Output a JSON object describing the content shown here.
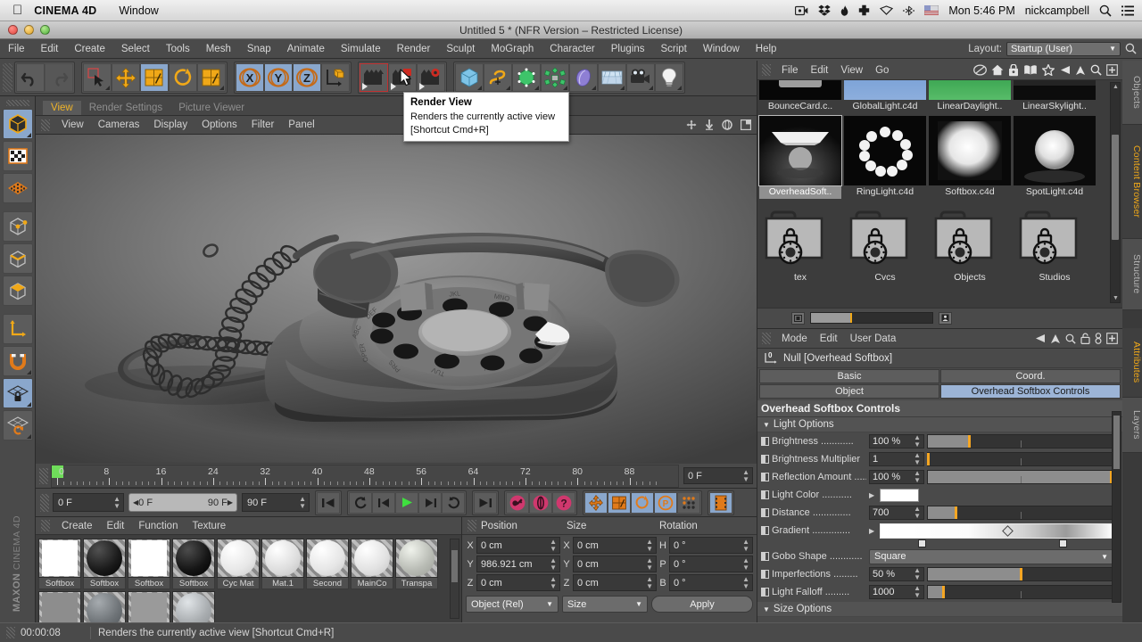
{
  "mac_menubar": {
    "apple_icon": "apple-icon",
    "app_name": "CINEMA 4D",
    "menus": [
      "Window"
    ],
    "status_icons": [
      "screen-recorder-icon",
      "dropbox-icon",
      "flame-icon",
      "cross-icon",
      "diamond-icon",
      "bluetooth-icon",
      "flag-icon"
    ],
    "clock": "Mon 5:46 PM",
    "user": "nickcampbell",
    "search_icon": "search-icon",
    "list_icon": "notification-center-icon"
  },
  "window": {
    "title": "Untitled 5 * (NFR Version – Restricted License)"
  },
  "c4d_menubar": {
    "items": [
      "File",
      "Edit",
      "Create",
      "Select",
      "Tools",
      "Mesh",
      "Snap",
      "Animate",
      "Simulate",
      "Render",
      "Sculpt",
      "MoGraph",
      "Character",
      "Plugins",
      "Script",
      "Window",
      "Help"
    ],
    "layout_label": "Layout:",
    "layout_value": "Startup (User)",
    "search_icon": "search-icon"
  },
  "toolbar": {
    "groups": [
      {
        "buttons": [
          {
            "name": "undo-button",
            "icon": "undo-icon",
            "state": "normal"
          },
          {
            "name": "redo-button",
            "icon": "redo-icon",
            "state": "disabled"
          }
        ]
      },
      {
        "buttons": [
          {
            "name": "live-selection-button",
            "icon": "selection-cursor-icon",
            "state": "normal"
          },
          {
            "name": "move-button",
            "icon": "move-icon",
            "state": "normal"
          },
          {
            "name": "scale-button",
            "icon": "scale-icon",
            "state": "active"
          },
          {
            "name": "rotate-button",
            "icon": "rotate-icon",
            "state": "normal"
          },
          {
            "name": "scale-alt-button",
            "icon": "scale-alt-icon",
            "state": "normal"
          }
        ]
      },
      {
        "buttons": [
          {
            "name": "x-axis-lock-button",
            "icon": "x-axis-icon",
            "state": "active",
            "label": "X"
          },
          {
            "name": "y-axis-lock-button",
            "icon": "y-axis-icon",
            "state": "active",
            "label": "Y"
          },
          {
            "name": "z-axis-lock-button",
            "icon": "z-axis-icon",
            "state": "active",
            "label": "Z"
          },
          {
            "name": "world-object-coordinate-button",
            "icon": "world-coordinate-icon",
            "state": "normal"
          }
        ]
      },
      {
        "buttons": [
          {
            "name": "render-view-button",
            "icon": "render-view-icon",
            "state": "hover"
          },
          {
            "name": "render-region-button",
            "icon": "render-region-icon",
            "state": "normal"
          },
          {
            "name": "render-settings-button",
            "icon": "render-settings-icon",
            "state": "normal"
          }
        ]
      },
      {
        "buttons": [
          {
            "name": "cube-primitive-button",
            "icon": "cube-icon",
            "state": "normal"
          },
          {
            "name": "spline-button",
            "icon": "spline-icon",
            "state": "normal"
          },
          {
            "name": "generator-button",
            "icon": "subdivision-surface-icon",
            "state": "normal"
          },
          {
            "name": "deformer-button",
            "icon": "deformer-icon",
            "state": "normal"
          },
          {
            "name": "environment-button",
            "icon": "environment-icon",
            "state": "normal"
          },
          {
            "name": "floor-scene-button",
            "icon": "floor-icon",
            "state": "normal"
          },
          {
            "name": "camera-button",
            "icon": "camera-icon",
            "state": "normal"
          },
          {
            "name": "light-button",
            "icon": "light-bulb-icon",
            "state": "normal"
          }
        ]
      }
    ]
  },
  "tooltip": {
    "title": "Render View",
    "description": "Renders the currently active view",
    "shortcut": "[Shortcut Cmd+R]"
  },
  "left_palette": {
    "buttons": [
      {
        "name": "model-mode-button",
        "icon": "model-cube-icon",
        "state": "active"
      },
      {
        "name": "texture-mode-button",
        "icon": "texture-checker-icon",
        "state": "normal"
      },
      {
        "name": "points-mode-button",
        "icon": "points-grid-icon",
        "state": "normal"
      },
      {
        "name": "point-mode-button",
        "icon": "point-vertex-icon",
        "state": "normal"
      },
      {
        "name": "edge-mode-button",
        "icon": "edge-icon",
        "state": "normal"
      },
      {
        "name": "polygon-mode-button",
        "icon": "polygon-icon",
        "state": "normal"
      },
      {
        "name": "axis-modify-button",
        "icon": "axis-icon",
        "state": "normal"
      },
      {
        "name": "enable-snap-button",
        "icon": "magnet-icon",
        "state": "normal"
      },
      {
        "name": "lock-workplane-button",
        "icon": "workplane-lock-icon",
        "state": "active"
      },
      {
        "name": "workplane-button",
        "icon": "workplane-icon",
        "state": "normal"
      }
    ],
    "brand_main": "MAXON",
    "brand_sub": "CINEMA 4D"
  },
  "viewport": {
    "tabs": [
      {
        "label": "View",
        "selected": true
      },
      {
        "label": "Render Settings",
        "selected": false
      },
      {
        "label": "Picture Viewer",
        "selected": false
      }
    ],
    "menus": [
      "View",
      "Cameras",
      "Display",
      "Options",
      "Filter",
      "Panel"
    ],
    "corner_icons": [
      "pan-icon",
      "zoom-icon",
      "rotate-icon",
      "layout-icon"
    ]
  },
  "timeline": {
    "ticks": [
      "0",
      "8",
      "16",
      "24",
      "32",
      "40",
      "48",
      "56",
      "64",
      "72",
      "80",
      "88"
    ],
    "current_frame_field": "0 F",
    "playhead_frame": 0
  },
  "transport": {
    "current_frame": "0 F",
    "range_start": "0 F",
    "range_end": "90 F",
    "end_frame": "90 F",
    "buttons": [
      {
        "name": "goto-start-button",
        "icon": "skip-back-icon"
      },
      {
        "name": "previous-key-button",
        "icon": "prev-key-icon"
      },
      {
        "name": "step-back-button",
        "icon": "step-back-icon"
      },
      {
        "name": "play-button",
        "icon": "play-icon"
      },
      {
        "name": "step-forward-button",
        "icon": "step-forward-icon"
      },
      {
        "name": "next-key-button",
        "icon": "next-key-icon"
      },
      {
        "name": "goto-end-button",
        "icon": "skip-forward-icon"
      },
      {
        "name": "record-keyframe-button",
        "icon": "record-key-icon"
      },
      {
        "name": "autokey-button",
        "icon": "autokey-icon"
      },
      {
        "name": "keyframe-selection-button",
        "icon": "question-key-icon"
      },
      {
        "name": "position-key-button",
        "icon": "position-key-icon"
      },
      {
        "name": "scale-key-button",
        "icon": "scale-key-icon"
      },
      {
        "name": "rotation-key-button",
        "icon": "rotation-key-icon"
      },
      {
        "name": "param-key-button",
        "icon": "param-key-icon"
      },
      {
        "name": "pla-key-button",
        "icon": "pla-key-icon"
      },
      {
        "name": "timeline-button",
        "icon": "timeline-icon"
      }
    ]
  },
  "materials": {
    "menus": [
      "Create",
      "Edit",
      "Function",
      "Texture"
    ],
    "items": [
      {
        "label": "Softbox",
        "type": "square",
        "color": "#ffffff"
      },
      {
        "label": "Softbox",
        "type": "sphere",
        "color": "#1a1a1a"
      },
      {
        "label": "Softbox",
        "type": "square",
        "color": "#ffffff"
      },
      {
        "label": "Softbox",
        "type": "sphere",
        "color": "#151515"
      },
      {
        "label": "Cyc Mat",
        "type": "sphere",
        "color": "#e8e8e8"
      },
      {
        "label": "Mat.1",
        "type": "sphere",
        "color": "#dedede"
      },
      {
        "label": "Second",
        "type": "sphere",
        "color": "#e6e6e6"
      },
      {
        "label": "MainCo",
        "type": "sphere",
        "color": "#e2e2e2"
      },
      {
        "label": "Transpa",
        "type": "sphere",
        "color": "#b9bcb5"
      },
      {
        "label": "",
        "type": "square",
        "color": "#8d8d8d"
      },
      {
        "label": "",
        "type": "sphere",
        "color": "#6f7478"
      },
      {
        "label": "",
        "type": "square",
        "color": "#9a9a9a"
      },
      {
        "label": "",
        "type": "sphere",
        "color": "#a9adb0"
      }
    ]
  },
  "coordinates": {
    "headers": [
      "Position",
      "Size",
      "Rotation"
    ],
    "position": [
      {
        "axis": "X",
        "value": "0 cm"
      },
      {
        "axis": "Y",
        "value": "986.921 cm"
      },
      {
        "axis": "Z",
        "value": "0 cm"
      }
    ],
    "size": [
      {
        "axis": "X",
        "value": "0 cm"
      },
      {
        "axis": "Y",
        "value": "0 cm"
      },
      {
        "axis": "Z",
        "value": "0 cm"
      }
    ],
    "rotation": [
      {
        "axis": "H",
        "value": "0 °"
      },
      {
        "axis": "P",
        "value": "0 °"
      },
      {
        "axis": "B",
        "value": "0 °"
      }
    ],
    "mode_select": "Object (Rel)",
    "size_select": "Size",
    "apply_button": "Apply"
  },
  "statusbar": {
    "time": "00:00:08",
    "message": "Renders the currently active view [Shortcut Cmd+R]"
  },
  "content_browser": {
    "menus": [
      "File",
      "Edit",
      "View",
      "Go"
    ],
    "icons": [
      "preset-icon",
      "home-icon",
      "lock-presets-icon",
      "catalog-icon",
      "favorites-icon",
      "back-arrow-icon",
      "up-arrow-icon",
      "search-icon",
      "add-panel-icon"
    ],
    "row1": [
      {
        "label": "BounceCard.c..",
        "thumb": "bouncecard"
      },
      {
        "label": "GlobalLight.c4d",
        "thumb": "globallight"
      },
      {
        "label": "LinearDaylight..",
        "thumb": "lineardaylight"
      },
      {
        "label": "LinearSkylight..",
        "thumb": "linearskylight"
      }
    ],
    "row2": [
      {
        "label": "OverheadSoft..",
        "thumb": "overheadsoftbox",
        "selected": true
      },
      {
        "label": "RingLight.c4d",
        "thumb": "ringlight",
        "selected": false
      },
      {
        "label": "Softbox.c4d",
        "thumb": "softbox",
        "selected": false
      },
      {
        "label": "SpotLight.c4d",
        "thumb": "spotlight",
        "selected": false
      }
    ],
    "row3": [
      {
        "label": "tex",
        "thumb": "folder"
      },
      {
        "label": "Cvcs",
        "thumb": "folder"
      },
      {
        "label": "Objects",
        "thumb": "folder"
      },
      {
        "label": "Studios",
        "thumb": "folder"
      }
    ]
  },
  "attributes": {
    "menus": [
      "Mode",
      "Edit",
      "User Data"
    ],
    "icons": [
      "back-arrow-icon",
      "up-arrow-icon",
      "search-icon",
      "lock-icon",
      "link-icon",
      "add-panel-icon"
    ],
    "object_icon": "null-object-icon",
    "object_name": "Null [Overhead Softbox]",
    "tabs_row1": [
      {
        "label": "Basic",
        "selected": false
      },
      {
        "label": "Coord.",
        "selected": false
      }
    ],
    "tabs_row2": [
      {
        "label": "Object",
        "selected": false
      },
      {
        "label": "Overhead Softbox Controls",
        "selected": true
      }
    ],
    "section_title": "Overhead Softbox Controls",
    "subsection_title": "Light Options",
    "subsection2_title": "Size Options",
    "params": [
      {
        "label": "Brightness",
        "dots": true,
        "value": "100 %",
        "slider": {
          "fill": 22,
          "knob": 22
        }
      },
      {
        "label": "Brightness Multiplier",
        "dots": false,
        "value": "1",
        "slider": {
          "fill": 0,
          "knob": 0
        }
      },
      {
        "label": "Reflection Amount",
        "dots": true,
        "value": "100 %",
        "slider": {
          "fill": 99,
          "knob": 99
        }
      },
      {
        "label": "Light Color",
        "dots": true,
        "type": "color",
        "color": "#ffffff"
      },
      {
        "label": "Distance",
        "dots": true,
        "value": "700",
        "slider": {
          "fill": 15,
          "knob": 15
        }
      },
      {
        "label": "Gradient",
        "dots": true,
        "type": "gradient"
      },
      {
        "label": "Gobo Shape",
        "dots": true,
        "type": "dropdown",
        "value": "Square"
      },
      {
        "label": "Imperfections",
        "dots": true,
        "value": "50 %",
        "slider": {
          "fill": 50,
          "knob": 50
        }
      },
      {
        "label": "Light Falloff",
        "dots": true,
        "value": "1000",
        "slider": {
          "fill": 8,
          "knob": 8
        }
      }
    ]
  },
  "vertical_tabs": [
    {
      "label": "Objects",
      "selected": false
    },
    {
      "label": "Content Browser",
      "selected": true
    },
    {
      "label": "Structure",
      "selected": false
    },
    {
      "label": "Attributes",
      "selected": true
    },
    {
      "label": "Layers",
      "selected": false
    }
  ],
  "colors": {
    "accent_orange": "#f0a818",
    "tab_blue": "#9cb4d6",
    "panel_bg": "#4a4a4a",
    "field_bg": "#393939"
  }
}
